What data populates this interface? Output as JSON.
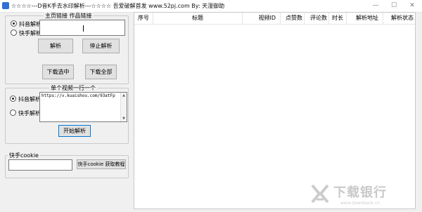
{
  "window": {
    "title": "☆☆☆☆---D音K手去水印解析---☆☆☆☆  吾爱破解首发  www.52pj.com    By:  天湿御助",
    "minimize": "—",
    "maximize": "☐",
    "close": "✕"
  },
  "home_group": {
    "legend": "主页链接  作品链接",
    "radio_douyin": "抖音解析",
    "radio_kuaishou": "快手解析",
    "input_value": "",
    "parse_button": "解析",
    "stop_button": "停止解析",
    "download_selected_button": "下载选中",
    "download_all_button": "下载全部"
  },
  "single_group": {
    "legend": "单个视频一行一个",
    "radio_douyin": "抖音解析",
    "radio_kuaishou": "快手解析",
    "textarea_value": "https://v.kuaishou.com/93atFp",
    "start_button": "开始解析"
  },
  "cookie_group": {
    "legend": "快手cookie",
    "input_value": "",
    "tutorial_button": "快手cookie 获取教程"
  },
  "table": {
    "columns": [
      "序号",
      "标题",
      "视频ID",
      "点赞数",
      "评论数",
      "时长",
      "解析地址",
      "解析状态"
    ],
    "rows": []
  },
  "watermark": {
    "text": "下载银行",
    "url": "www.downbank.cn"
  },
  "colors": {
    "background": "#f0f0f0",
    "button_face": "#e1e1e1",
    "focus_border": "#0078d7",
    "icon_blue": "#2f6fd6"
  }
}
